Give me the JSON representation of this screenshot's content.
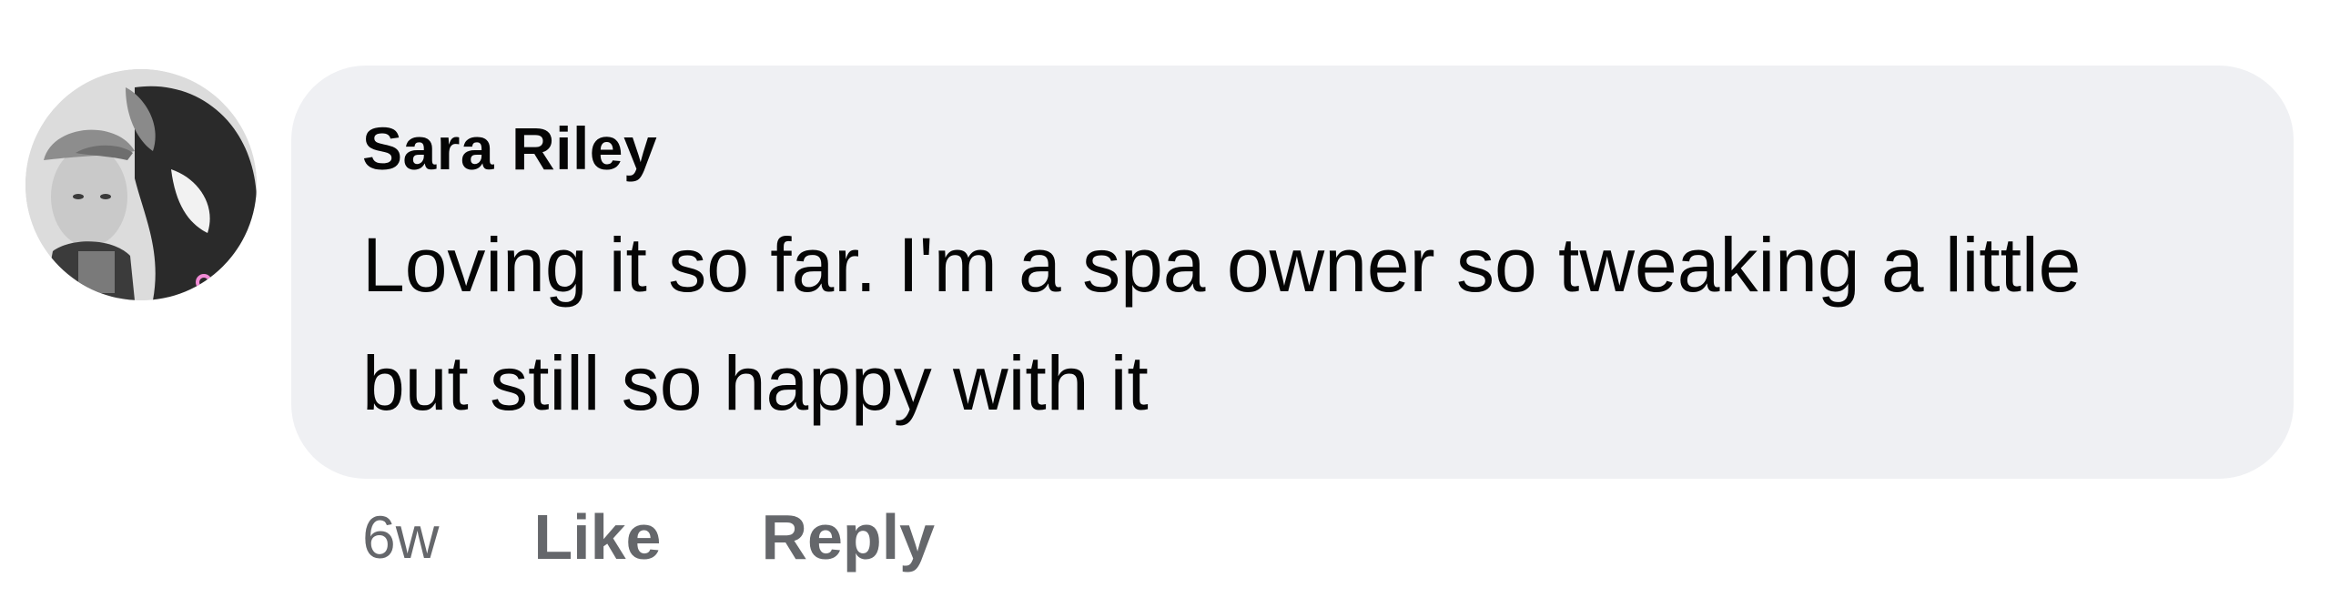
{
  "comment": {
    "author": "Sara Riley",
    "text": "Loving it so far. I'm a spa owner so tweaking a little but still so happy with it",
    "timestamp": "6w",
    "actions": {
      "like_label": "Like",
      "reply_label": "Reply"
    },
    "avatar_icon": "user-avatar-photo"
  },
  "colors": {
    "bubble_bg": "#eff0f3",
    "text": "#050505",
    "meta_text": "#65676b"
  }
}
